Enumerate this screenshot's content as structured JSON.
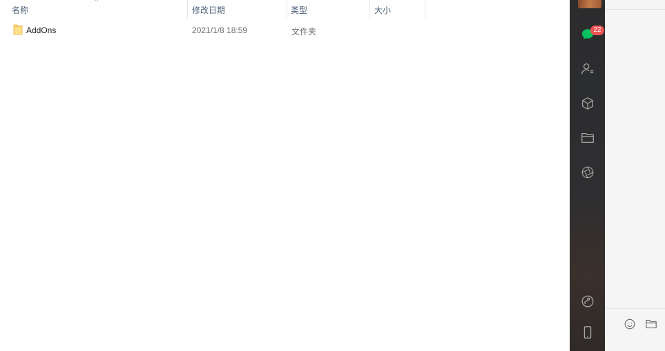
{
  "explorer": {
    "columns": {
      "name": "名称",
      "date": "修改日期",
      "type": "类型",
      "size": "大小"
    },
    "sort_indicator": "^",
    "files": [
      {
        "name": "AddOns",
        "date": "2021/1/8 18:59",
        "type": "文件夹",
        "size": "",
        "icon": "folder-icon"
      }
    ]
  },
  "wechat": {
    "badge_count": "22",
    "nav": [
      "chat-icon",
      "contacts-icon",
      "favorites-icon",
      "files-icon",
      "moments-icon",
      "miniprogram-icon",
      "phone-icon"
    ],
    "toolbar": [
      "emoji-icon",
      "folder-icon"
    ],
    "colors": {
      "sidebar": "#2e2e30",
      "badge": "#f05352",
      "chat_active": "#07c160",
      "folder": "#ffd86b"
    }
  }
}
